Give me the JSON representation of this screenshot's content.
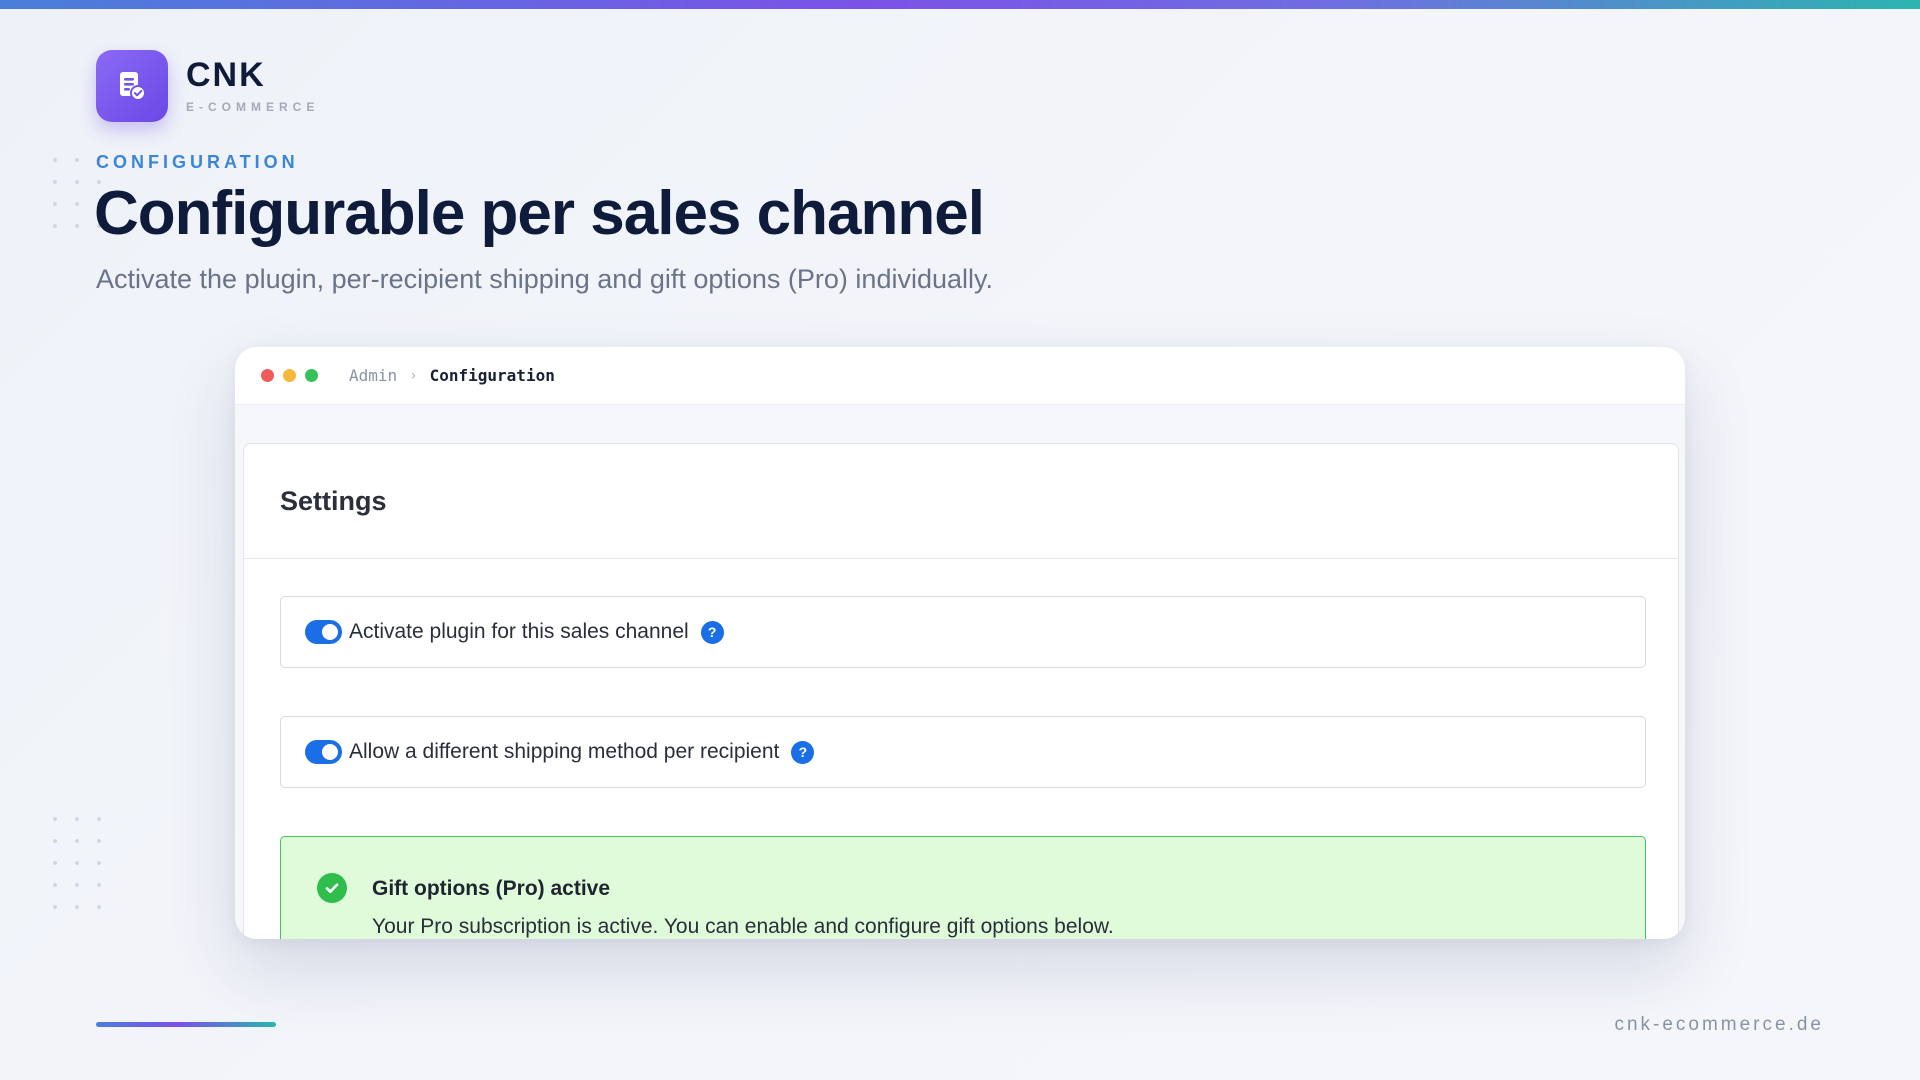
{
  "brand": {
    "name": "CNK",
    "tagline": "E-COMMERCE",
    "icon": "document-check-icon",
    "accent": "#7354ea"
  },
  "hero": {
    "eyebrow": "CONFIGURATION",
    "title": "Configurable per sales channel",
    "subtitle": "Activate the plugin, per-recipient shipping and gift options (Pro) individually."
  },
  "window": {
    "breadcrumb": [
      "Admin",
      "Configuration"
    ],
    "breadcrumb_separator": "›"
  },
  "settings": {
    "title": "Settings",
    "rows": [
      {
        "label": "Activate plugin for this sales channel",
        "enabled": true,
        "help": "?"
      },
      {
        "label": "Allow a different shipping method per recipient",
        "enabled": true,
        "help": "?"
      }
    ],
    "alert": {
      "title": "Gift options (Pro) active",
      "text": "Your Pro subscription is active. You can enable and configure gift options below.",
      "status_color": "#2fbe4c"
    }
  },
  "footer": {
    "url": "cnk-ecommerce.de"
  }
}
